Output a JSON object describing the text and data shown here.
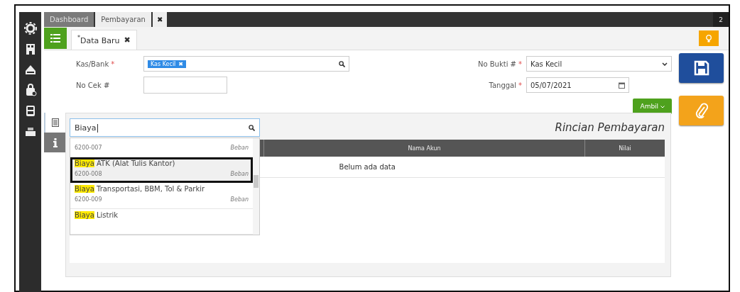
{
  "top_tabs": [
    {
      "label": "Dashboard",
      "selected": false
    },
    {
      "label": "Pembayaran",
      "selected": true
    }
  ],
  "top_close": "✖",
  "user_menu": "2",
  "sub_tab": {
    "label": "Data Baru",
    "modified_mark": "*",
    "close": "✖"
  },
  "form": {
    "kas_bank": {
      "label": "Kas/Bank",
      "required_mark": "*",
      "chips": [
        {
          "label": "Kas Kecil",
          "remove": "✖"
        }
      ]
    },
    "no_cek": {
      "label": "No Cek #"
    },
    "no_bukti": {
      "label": "No Bukti #",
      "required_mark": "*",
      "value": "Kas Kecil"
    },
    "tanggal": {
      "label": "Tanggal",
      "required_mark": "*",
      "value": "05/07/2021"
    },
    "ambil_button": "Ambil"
  },
  "side_tabs": [
    {
      "kind": "detail",
      "selected": true
    },
    {
      "kind": "info",
      "selected": false
    }
  ],
  "panel": {
    "title": "Rincian Pembayaran",
    "search": {
      "value": "Biaya"
    },
    "suggestions": [
      {
        "code": "6200-007",
        "category": "Beban",
        "selected": false
      },
      {
        "match": "Biaya",
        "rest": " ATK (Alat Tulis Kantor)",
        "code": "6200-008",
        "category": "Beban",
        "selected": true
      },
      {
        "match": "Biaya",
        "rest": " Transportasi, BBM, Tol & Parkir",
        "code": "6200-009",
        "category": "Beban",
        "selected": false
      },
      {
        "match": "Biaya",
        "rest": " Listrik",
        "selected": false
      }
    ],
    "table": {
      "columns": [
        "Nama Akun",
        "Nilai"
      ],
      "empty_text": "Belum ada data"
    }
  }
}
